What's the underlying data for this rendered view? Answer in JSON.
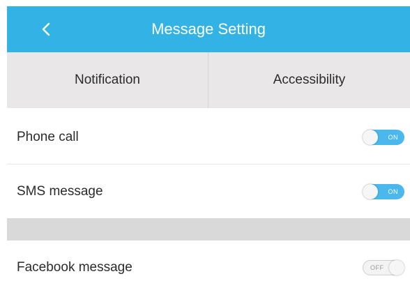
{
  "header": {
    "title": "Message Setting",
    "back_icon": "chevron-left-icon",
    "background_color": "#33b3e5"
  },
  "tabs": [
    {
      "label": "Notification"
    },
    {
      "label": "Accessibility"
    }
  ],
  "settings": [
    {
      "label": "Phone call",
      "toggle_state": "ON",
      "enabled": true
    },
    {
      "label": "SMS message",
      "toggle_state": "ON",
      "enabled": true
    },
    {
      "label": "Facebook message",
      "toggle_state": "OFF",
      "enabled": false
    }
  ],
  "colors": {
    "toggle_on": "#4ab8ec",
    "toggle_off": "#f3f3f3",
    "tab_background": "#e9e7e7",
    "section_separator": "#d9d9d9"
  }
}
